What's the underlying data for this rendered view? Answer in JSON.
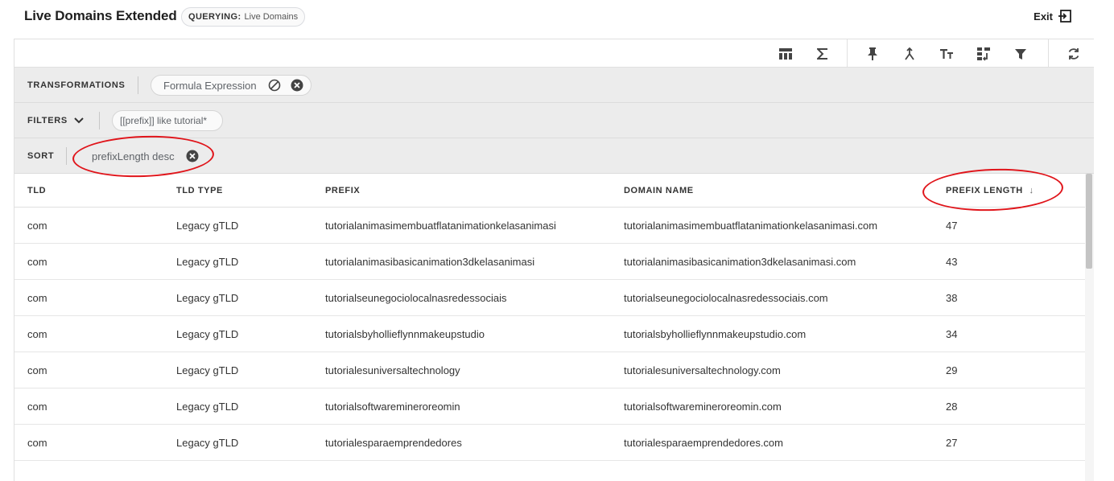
{
  "header": {
    "title": "Live Domains Extended",
    "querying_label": "QUERYING:",
    "querying_value": "Live Domains",
    "exit_label": "Exit"
  },
  "toolbar": {
    "icons": [
      "table-columns-icon",
      "sigma-icon",
      "pin-icon",
      "merge-icon",
      "text-format-icon",
      "swap-icon",
      "filter-icon",
      "refresh-icon"
    ]
  },
  "transformations": {
    "label": "TRANSFORMATIONS",
    "chip": "Formula Expression"
  },
  "filters": {
    "label": "FILTERS",
    "chip": "[[prefix]] like tutorial*"
  },
  "sort": {
    "label": "SORT",
    "chip": "prefixLength desc"
  },
  "table": {
    "headers": [
      "TLD",
      "TLD TYPE",
      "PREFIX",
      "DOMAIN NAME",
      "PREFIX LENGTH"
    ],
    "sort_indicator": "↓",
    "rows": [
      [
        "com",
        "Legacy gTLD",
        "tutorialanimasimembuatflatanimationkelasanimasi",
        "tutorialanimasimembuatflatanimationkelasanimasi.com",
        "47"
      ],
      [
        "com",
        "Legacy gTLD",
        "tutorialanimasibasicanimation3dkelasanimasi",
        "tutorialanimasibasicanimation3dkelasanimasi.com",
        "43"
      ],
      [
        "com",
        "Legacy gTLD",
        "tutorialseunegociolocalnasredessociais",
        "tutorialseunegociolocalnasredessociais.com",
        "38"
      ],
      [
        "com",
        "Legacy gTLD",
        "tutorialsbyhollieflynnmakeupstudio",
        "tutorialsbyhollieflynnmakeupstudio.com",
        "34"
      ],
      [
        "com",
        "Legacy gTLD",
        "tutorialesuniversaltechnology",
        "tutorialesuniversaltechnology.com",
        "29"
      ],
      [
        "com",
        "Legacy gTLD",
        "tutorialsoftwaremineroreomin",
        "tutorialsoftwaremineroreomin.com",
        "28"
      ],
      [
        "com",
        "Legacy gTLD",
        "tutorialesparaemprendedores",
        "tutorialesparaemprendedores.com",
        "27"
      ]
    ]
  },
  "colors": {
    "annotation": "#e0141a",
    "band": "#ececec"
  }
}
